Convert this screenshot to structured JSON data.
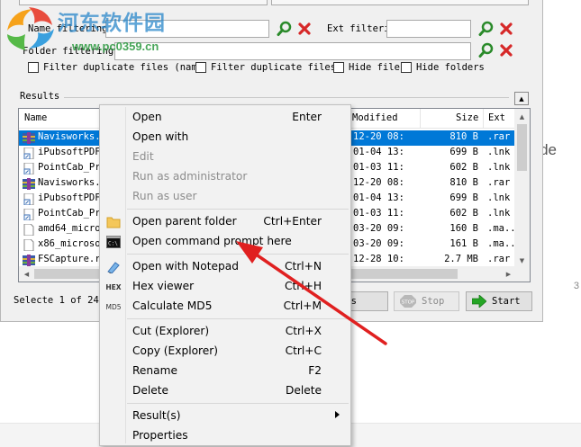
{
  "watermark": {
    "text": "河东软件园",
    "url": "www.pc0359.cn"
  },
  "background": {
    "side_text": "de",
    "side_number": "3"
  },
  "filters": {
    "name_label": "Name filtering:",
    "ext_label": "Ext filtering:",
    "folder_label": "Folder filtering:",
    "name_value": "",
    "ext_value": "",
    "folder_value": ""
  },
  "options": [
    {
      "label": "Filter duplicate files (name",
      "checked": false
    },
    {
      "label": "Filter duplicate files",
      "checked": false
    },
    {
      "label": "Hide files",
      "checked": false
    },
    {
      "label": "Hide folders",
      "checked": false
    }
  ],
  "results": {
    "label": "Results",
    "columns": {
      "name": "Name",
      "modified": "Modified",
      "size": "Size",
      "ext": "Ext"
    },
    "rows": [
      {
        "name": "Navisworks.2",
        "modified": "12-20 08:",
        "size": "810 B",
        "ext": ".rar",
        "icon": "rar-archive-icon",
        "selected": true
      },
      {
        "name": "iPubsoftPDF",
        "modified": "01-04 13:",
        "size": "699 B",
        "ext": ".lnk",
        "icon": "shortcut-file-icon",
        "selected": false
      },
      {
        "name": "PointCab_Pr",
        "modified": "01-03 11:",
        "size": "602 B",
        "ext": ".lnk",
        "icon": "shortcut-file-icon",
        "selected": false
      },
      {
        "name": "Navisworks.2",
        "modified": "12-20 08:",
        "size": "810 B",
        "ext": ".rar",
        "icon": "rar-archive-icon",
        "selected": false
      },
      {
        "name": "iPubsoftPDF",
        "modified": "01-04 13:",
        "size": "699 B",
        "ext": ".lnk",
        "icon": "shortcut-file-icon",
        "selected": false
      },
      {
        "name": "PointCab_Pr",
        "modified": "01-03 11:",
        "size": "602 B",
        "ext": ".lnk",
        "icon": "shortcut-file-icon",
        "selected": false
      },
      {
        "name": "amd64_micros",
        "modified": "03-20 09:",
        "size": "160 B",
        "ext": ".ma..",
        "icon": "blank-file-icon",
        "selected": false
      },
      {
        "name": "x86_microsof",
        "modified": "03-20 09:",
        "size": "161 B",
        "ext": ".ma..",
        "icon": "blank-file-icon",
        "selected": false
      },
      {
        "name": "FSCapture.ra",
        "modified": "12-28 10:",
        "size": "2.7 MB",
        "ext": ".rar",
        "icon": "rar-archive-icon",
        "selected": false
      }
    ]
  },
  "status": {
    "text": "Selecte 1 of 24 c"
  },
  "buttons": {
    "partial_label": "s",
    "stop_label": "Stop",
    "start_label": "Start"
  },
  "context_menu": {
    "items": [
      {
        "label": "Open",
        "shortcut": "Enter",
        "enabled": true
      },
      {
        "label": "Open with",
        "shortcut": "",
        "enabled": true
      },
      {
        "label": "Edit",
        "shortcut": "",
        "enabled": false
      },
      {
        "label": "Run as administrator",
        "shortcut": "",
        "enabled": false
      },
      {
        "label": "Run as user",
        "shortcut": "",
        "enabled": false
      },
      {
        "label": "Open parent folder",
        "shortcut": "Ctrl+Enter",
        "enabled": true,
        "icon": "folder-icon"
      },
      {
        "label": "Open command prompt here",
        "shortcut": "",
        "enabled": true,
        "icon": "command-prompt-icon"
      },
      {
        "label": "Open with Notepad",
        "shortcut": "Ctrl+N",
        "enabled": true,
        "icon": "notepad-icon"
      },
      {
        "label": "Hex viewer",
        "shortcut": "Ctrl+H",
        "enabled": true,
        "icon": "hex-icon",
        "icon_text": "HEX"
      },
      {
        "label": "Calculate MD5",
        "shortcut": "Ctrl+M",
        "enabled": true,
        "icon": "md5-icon",
        "icon_text": "MD5"
      },
      {
        "label": "Cut (Explorer)",
        "shortcut": "Ctrl+X",
        "enabled": true
      },
      {
        "label": "Copy (Explorer)",
        "shortcut": "Ctrl+C",
        "enabled": true
      },
      {
        "label": "Rename",
        "shortcut": "F2",
        "enabled": true
      },
      {
        "label": "Delete",
        "shortcut": "Delete",
        "enabled": true
      },
      {
        "label": "Result(s)",
        "shortcut": "",
        "enabled": true,
        "submenu": true
      },
      {
        "label": "Properties",
        "shortcut": "",
        "enabled": true
      }
    ]
  },
  "colors": {
    "selection": "#0078d7",
    "annotation_arrow": "#e02020",
    "watermark_blue": "#2182c8",
    "watermark_green": "#28963c"
  }
}
